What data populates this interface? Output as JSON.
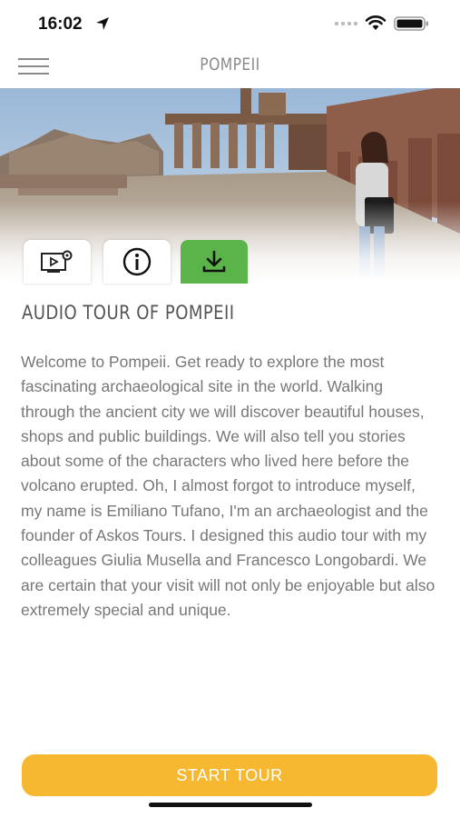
{
  "status_bar": {
    "time": "16:02",
    "icons": [
      "location-arrow-icon",
      "signal-dots-icon",
      "wifi-icon",
      "battery-icon"
    ]
  },
  "nav": {
    "title": "POMPEII",
    "menu_icon": "hamburger-menu-icon"
  },
  "hero": {
    "image": "pompeii-forum-photo"
  },
  "tabs": [
    {
      "name": "video-settings",
      "icon": "video-settings-icon",
      "active": false
    },
    {
      "name": "info",
      "icon": "info-icon",
      "active": false
    },
    {
      "name": "download",
      "icon": "download-icon",
      "active": true,
      "color": "#5bb44a"
    }
  ],
  "tour": {
    "title": "AUDIO TOUR OF POMPEII",
    "description": "Welcome to Pompeii. Get ready to explore the most fascinating archaeological site in the world. Walking through the ancient city we will discover beautiful houses, shops and public buildings. We will also tell you stories about some of the characters who lived here before the volcano erupted. Oh, I almost forgot to introduce myself, my name is Emiliano Tufano, I'm an archaeologist and the founder of Askos Tours. I designed this audio tour with my colleagues Giulia Musella and Francesco Longobardi. We are certain that your visit will not only be enjoyable but also extremely special and unique."
  },
  "start_button": {
    "label": "START TOUR",
    "color": "#f6b830"
  }
}
